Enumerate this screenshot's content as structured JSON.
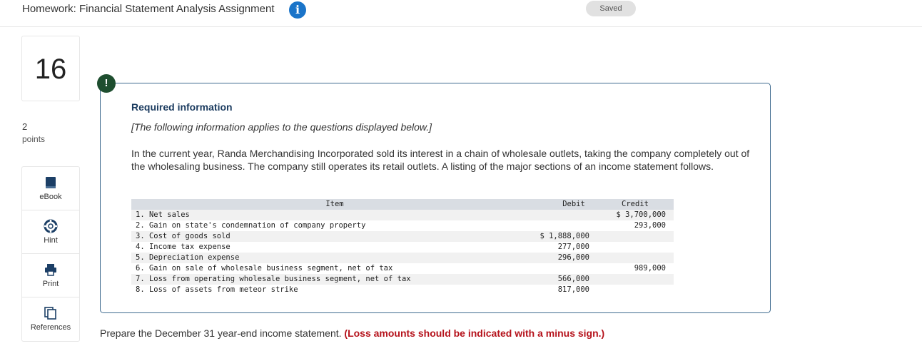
{
  "header": {
    "title": "Homework: Financial Statement Analysis Assignment",
    "info_icon": "info-icon",
    "saved_label": "Saved"
  },
  "question": {
    "number": "16",
    "points_value": "2",
    "points_label": "points"
  },
  "tools": [
    {
      "label": "eBook",
      "icon": "book-icon"
    },
    {
      "label": "Hint",
      "icon": "lifebuoy-icon"
    },
    {
      "label": "Print",
      "icon": "printer-icon"
    },
    {
      "label": "References",
      "icon": "documents-icon"
    }
  ],
  "required_info": {
    "badge": "!",
    "title": "Required information",
    "note": "[The following information applies to the questions displayed below.]",
    "paragraph": "In the current year, Randa Merchandising Incorporated sold its interest in a chain of wholesale outlets, taking the company completely out of the wholesaling business. The company still operates its retail outlets. A listing of the major sections of an income statement follows."
  },
  "table": {
    "headers": {
      "item": "Item",
      "debit": "Debit",
      "credit": "Credit"
    },
    "rows": [
      {
        "item": "1. Net sales",
        "debit": "",
        "credit": "$ 3,700,000"
      },
      {
        "item": "2. Gain on state's condemnation of company property",
        "debit": "",
        "credit": "293,000"
      },
      {
        "item": "3. Cost of goods sold",
        "debit": "$ 1,888,000",
        "credit": ""
      },
      {
        "item": "4. Income tax expense",
        "debit": "277,000",
        "credit": ""
      },
      {
        "item": "5. Depreciation expense",
        "debit": "296,000",
        "credit": ""
      },
      {
        "item": "6. Gain on sale of wholesale business segment, net of tax",
        "debit": "",
        "credit": "989,000"
      },
      {
        "item": "7. Loss from operating wholesale business segment, net of tax",
        "debit": "566,000",
        "credit": ""
      },
      {
        "item": "8. Loss of assets from meteor strike",
        "debit": "817,000",
        "credit": ""
      }
    ]
  },
  "prompt": {
    "text": "Prepare the December 31 year-end income statement.",
    "emphasis": "(Loss amounts should be indicated with a minus sign.)"
  },
  "colors": {
    "accent_blue": "#1a74c9",
    "box_border": "#3f6b8f",
    "badge_green": "#1e4e2f",
    "emphasis_red": "#b5121b"
  }
}
